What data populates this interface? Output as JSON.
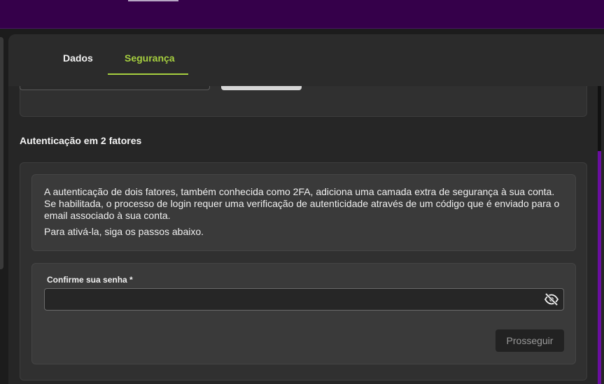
{
  "tabs": [
    {
      "label": "Dados",
      "active": false
    },
    {
      "label": "Segurança",
      "active": true
    }
  ],
  "section": {
    "title": "Autenticação em 2 fatores"
  },
  "info": {
    "paragraph1": "A autenticação de dois fatores, também conhecida como 2FA, adiciona uma camada extra de segurança à sua conta. Se habilitada, o processo de login requer uma verificação de autenticidade através de um código que é enviado para o email associado à sua conta.",
    "paragraph2": "Para ativá-la, siga os passos abaixo."
  },
  "form": {
    "password_label": "Confirme sua senha *",
    "password_value": "",
    "visibility_icon": "eye-off-icon",
    "proceed_label": "Prosseguir"
  },
  "colors": {
    "accent": "#a6cf3f",
    "header": "#35004a",
    "scrollbar": "#6a0ea0"
  }
}
